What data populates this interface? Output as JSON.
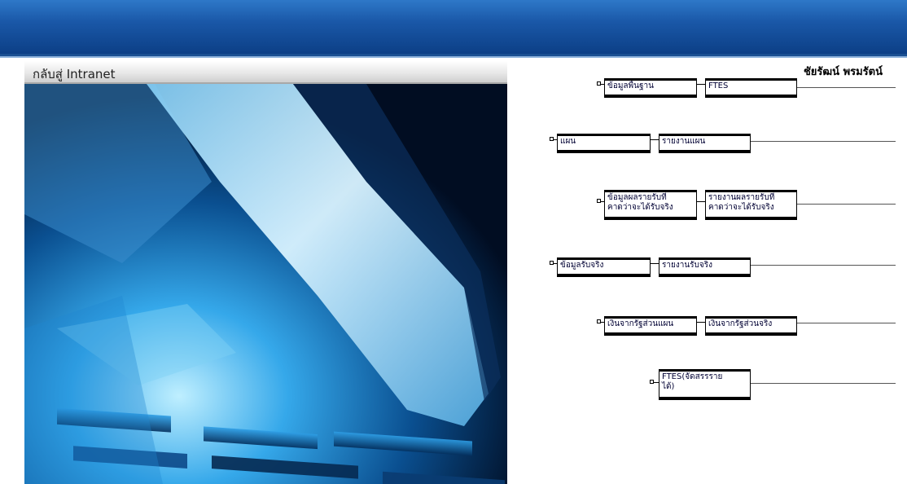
{
  "header": {
    "back_to_intranet": "กลับสู่ Intranet",
    "user_name": "ชัยรัฒน์ พรมรัตน์"
  },
  "colors": {
    "banner": "#1a58a8",
    "node_border": "#000000"
  },
  "org_chart": {
    "rows": [
      {
        "primary": "ข้อมูลพื้นฐาน",
        "secondary": "FTES"
      },
      {
        "primary": "แผน",
        "secondary": "รายงานแผน"
      },
      {
        "primary": "ข้อมูลผลรายรับที่\nคาดว่าจะได้รับจริง",
        "secondary": "รายงานผลรายรับที่\nคาดว่าจะได้รับจริง"
      },
      {
        "primary": "ข้อมูลรับจริง",
        "secondary": "รายงานรับจริง"
      },
      {
        "primary": "เงินจากรัฐส่วนแผน",
        "secondary": "เงินจากรัฐส่วนจริง"
      },
      {
        "primary": "FTES(จัดสรรราย\nได้)"
      }
    ]
  }
}
